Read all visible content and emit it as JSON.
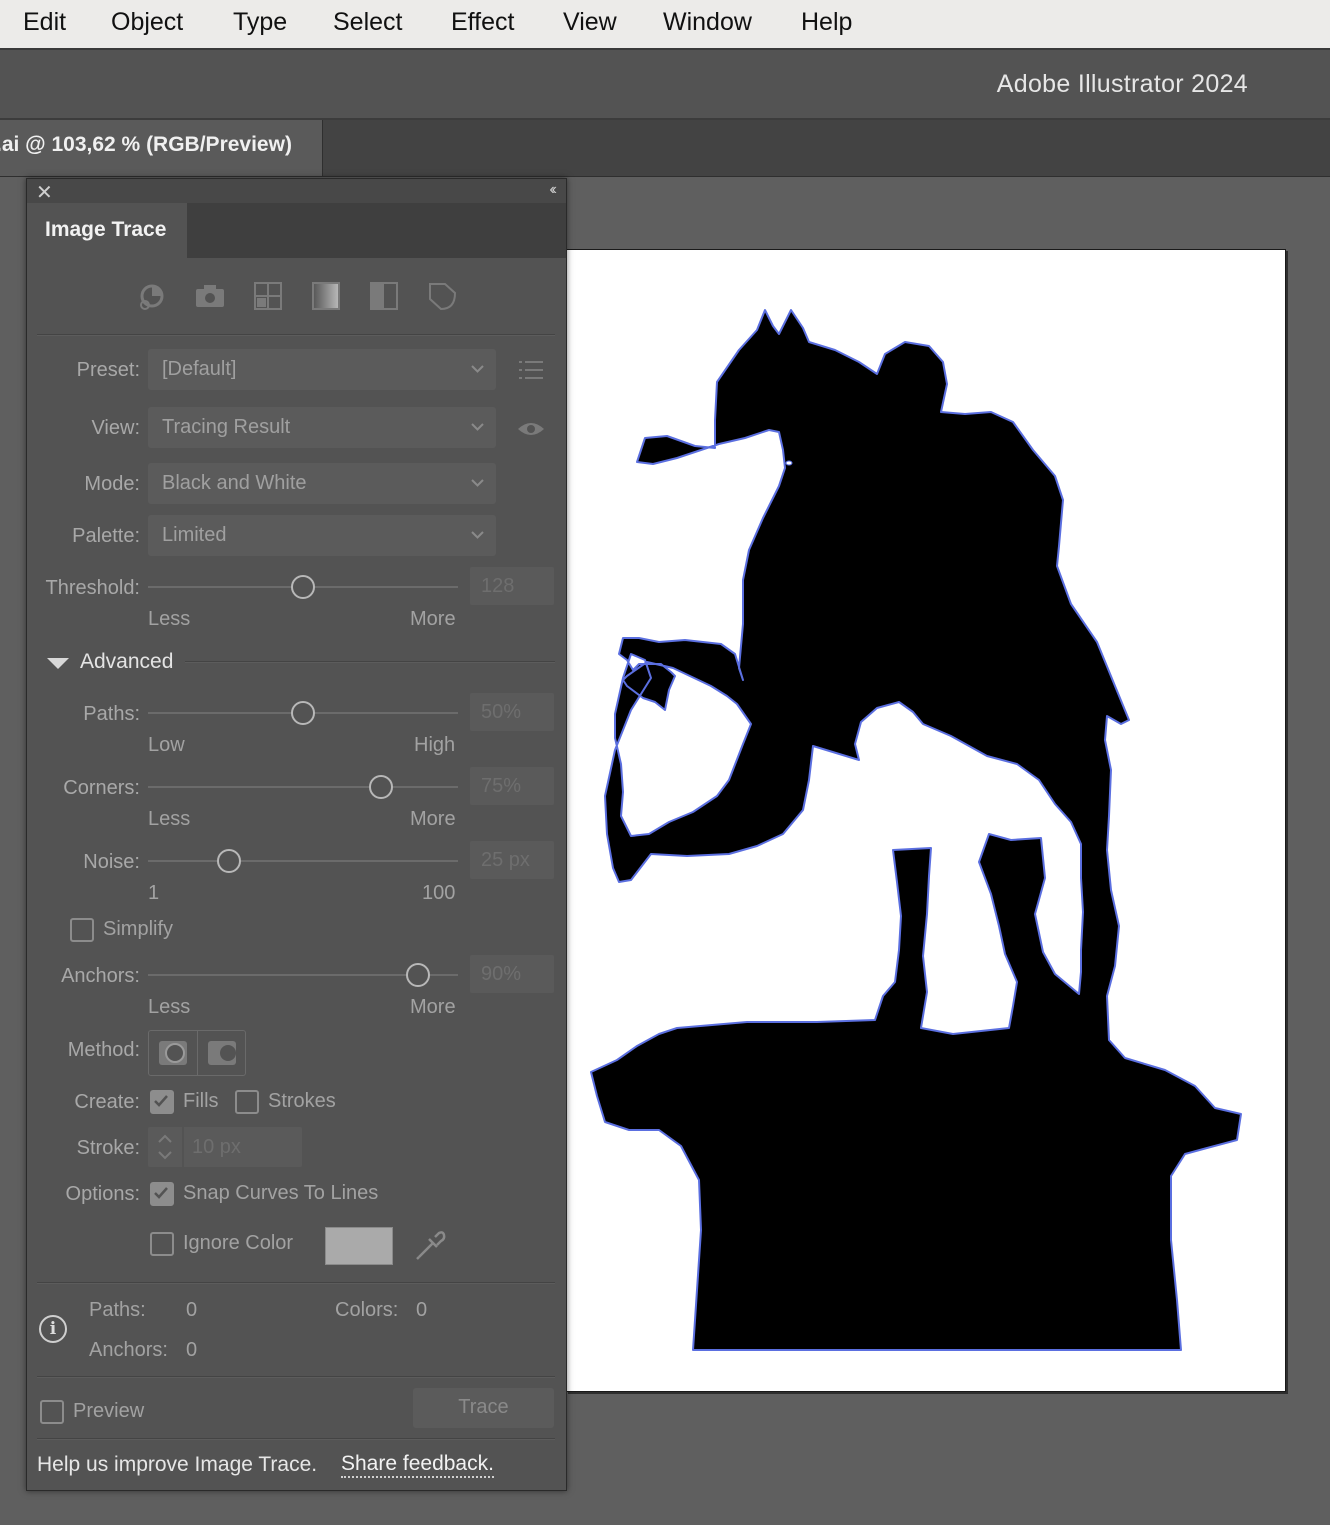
{
  "menubar": {
    "items": [
      "Edit",
      "Object",
      "Type",
      "Select",
      "Effect",
      "View",
      "Window",
      "Help"
    ]
  },
  "app": {
    "title": "Adobe Illustrator 2024"
  },
  "document": {
    "tab_label": ".ai @ 103,62 % (RGB/Preview)"
  },
  "panel": {
    "tab_title": "Image Trace",
    "preset_icons": [
      "auto-color-icon",
      "high-color-icon",
      "low-color-icon",
      "grayscale-icon",
      "black-white-icon",
      "outline-icon"
    ],
    "preset": {
      "label": "Preset:",
      "value": "[Default]"
    },
    "view": {
      "label": "View:",
      "value": "Tracing Result"
    },
    "mode": {
      "label": "Mode:",
      "value": "Black and White"
    },
    "palette": {
      "label": "Palette:",
      "value": "Limited"
    },
    "threshold": {
      "label": "Threshold:",
      "value": "128",
      "level": 0.5,
      "min_label": "Less",
      "max_label": "More"
    },
    "advanced": {
      "label": "Advanced",
      "expanded": true
    },
    "paths": {
      "label": "Paths:",
      "value": "50%",
      "level": 0.5,
      "min_label": "Low",
      "max_label": "High"
    },
    "corners": {
      "label": "Corners:",
      "value": "75%",
      "level": 0.75,
      "min_label": "Less",
      "max_label": "More"
    },
    "noise": {
      "label": "Noise:",
      "value": "25 px",
      "level": 0.26,
      "min_label": "1",
      "max_label": "100"
    },
    "simplify": {
      "label": "Simplify",
      "checked": false
    },
    "anchors": {
      "label": "Anchors:",
      "value": "90%",
      "level": 0.87,
      "min_label": "Less",
      "max_label": "More"
    },
    "method": {
      "label": "Method:"
    },
    "create": {
      "label": "Create:",
      "fills_label": "Fills",
      "fills_checked": true,
      "strokes_label": "Strokes",
      "strokes_checked": false
    },
    "stroke": {
      "label": "Stroke:",
      "value": "10 px"
    },
    "options": {
      "label": "Options:",
      "snap_label": "Snap Curves To Lines",
      "snap_checked": true,
      "ignore_label": "Ignore Color",
      "ignore_checked": false,
      "ignore_swatch_color": "#aaaaaa"
    },
    "info": {
      "paths_label": "Paths:",
      "paths_value": "0",
      "colors_label": "Colors:",
      "colors_value": "0",
      "anchors_label": "Anchors:",
      "anchors_value": "0"
    },
    "preview": {
      "label": "Preview",
      "checked": false
    },
    "trace_button": "Trace",
    "footer": {
      "text": "Help us improve Image Trace.",
      "link": "Share feedback."
    }
  },
  "colors": {
    "panel_bg": "#535353",
    "canvas_bg": "#5f5f5f",
    "artboard": "#ffffff",
    "trace_outline": "#5b6fe0"
  }
}
